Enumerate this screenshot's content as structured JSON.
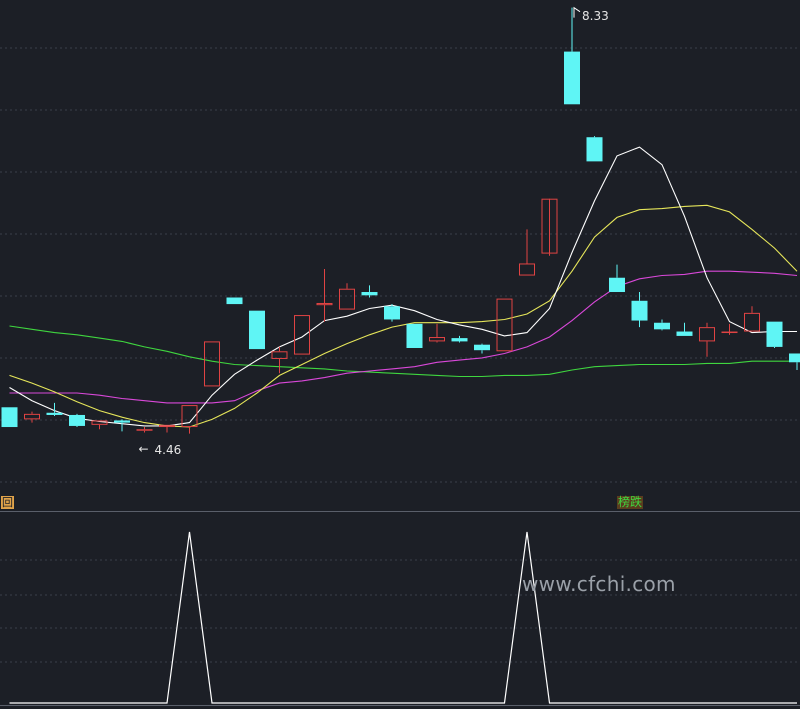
{
  "chart_data": [
    {
      "type": "candlestick",
      "colors": {
        "up": "#e04343",
        "down": "#5ff5f5",
        "ma_fast": "#ffffff",
        "ma_mid": "#e6e65a",
        "ma_slow": "#d948d9",
        "ma_long": "#3fd63f",
        "grid": "#3a3f4a"
      },
      "ylim": [
        3.9,
        8.4
      ],
      "high_label": "8.33",
      "low_label": "4.46",
      "signal_left": "回",
      "signal_right": "榜跌",
      "candles": [
        {
          "o": 4.69,
          "h": 4.69,
          "l": 4.51,
          "c": 4.51
        },
        {
          "o": 4.58,
          "h": 4.65,
          "l": 4.55,
          "c": 4.63
        },
        {
          "o": 4.64,
          "h": 4.73,
          "l": 4.61,
          "c": 4.62
        },
        {
          "o": 4.62,
          "h": 4.63,
          "l": 4.51,
          "c": 4.52
        },
        {
          "o": 4.53,
          "h": 4.57,
          "l": 4.49,
          "c": 4.57
        },
        {
          "o": 4.57,
          "h": 4.58,
          "l": 4.47,
          "c": 4.55
        },
        {
          "o": 4.49,
          "h": 4.51,
          "l": 4.46,
          "c": 4.49
        },
        {
          "o": 4.51,
          "h": 4.53,
          "l": 4.46,
          "c": 4.53
        },
        {
          "o": 4.51,
          "h": 4.71,
          "l": 4.45,
          "c": 4.71
        },
        {
          "o": 4.88,
          "h": 5.29,
          "l": 4.88,
          "c": 5.29
        },
        {
          "o": 5.69,
          "h": 5.69,
          "l": 5.63,
          "c": 5.63
        },
        {
          "o": 5.57,
          "h": 5.57,
          "l": 5.22,
          "c": 5.22
        },
        {
          "o": 5.13,
          "h": 5.24,
          "l": 5.0,
          "c": 5.2
        },
        {
          "o": 5.17,
          "h": 5.53,
          "l": 5.17,
          "c": 5.53
        },
        {
          "o": 5.62,
          "h": 5.95,
          "l": 5.47,
          "c": 5.64
        },
        {
          "o": 5.58,
          "h": 5.82,
          "l": 5.58,
          "c": 5.77
        },
        {
          "o": 5.74,
          "h": 5.8,
          "l": 5.69,
          "c": 5.71
        },
        {
          "o": 5.61,
          "h": 5.63,
          "l": 5.47,
          "c": 5.49
        },
        {
          "o": 5.45,
          "h": 5.45,
          "l": 5.23,
          "c": 5.23
        },
        {
          "o": 5.29,
          "h": 5.45,
          "l": 5.28,
          "c": 5.33
        },
        {
          "o": 5.32,
          "h": 5.34,
          "l": 5.28,
          "c": 5.29
        },
        {
          "o": 5.26,
          "h": 5.27,
          "l": 5.18,
          "c": 5.21
        },
        {
          "o": 5.2,
          "h": 5.68,
          "l": 5.2,
          "c": 5.68
        },
        {
          "o": 5.89,
          "h": 6.31,
          "l": 5.89,
          "c": 6.0
        },
        {
          "o": 6.09,
          "h": 6.09,
          "l": 6.07,
          "c": 6.59
        },
        {
          "o": 7.93,
          "h": 8.33,
          "l": 7.45,
          "c": 7.45
        },
        {
          "o": 7.15,
          "h": 7.16,
          "l": 6.93,
          "c": 6.93
        },
        {
          "o": 5.87,
          "h": 5.99,
          "l": 5.74,
          "c": 5.74
        },
        {
          "o": 5.66,
          "h": 5.74,
          "l": 5.42,
          "c": 5.48
        },
        {
          "o": 5.46,
          "h": 5.49,
          "l": 5.39,
          "c": 5.4
        },
        {
          "o": 5.38,
          "h": 5.46,
          "l": 5.34,
          "c": 5.34
        },
        {
          "o": 5.29,
          "h": 5.46,
          "l": 5.15,
          "c": 5.42
        },
        {
          "o": 5.37,
          "h": 5.45,
          "l": 5.35,
          "c": 5.38
        },
        {
          "o": 5.38,
          "h": 5.61,
          "l": 5.38,
          "c": 5.55
        },
        {
          "o": 5.47,
          "h": 5.47,
          "l": 5.23,
          "c": 5.24
        },
        {
          "o": 5.18,
          "h": 5.18,
          "l": 5.03,
          "c": 5.1
        }
      ],
      "ma_fast": [
        4.87,
        4.75,
        4.66,
        4.59,
        4.56,
        4.54,
        4.52,
        4.52,
        4.55,
        4.8,
        4.99,
        5.12,
        5.24,
        5.33,
        5.48,
        5.52,
        5.59,
        5.62,
        5.57,
        5.49,
        5.44,
        5.4,
        5.34,
        5.37,
        5.59,
        6.1,
        6.57,
        6.98,
        7.06,
        6.9,
        6.43,
        5.87,
        5.47,
        5.37,
        5.38,
        5.38
      ],
      "ma_mid": [
        4.98,
        4.91,
        4.83,
        4.74,
        4.66,
        4.6,
        4.55,
        4.52,
        4.51,
        4.58,
        4.68,
        4.82,
        4.98,
        5.08,
        5.18,
        5.27,
        5.35,
        5.42,
        5.46,
        5.46,
        5.46,
        5.47,
        5.49,
        5.54,
        5.66,
        5.93,
        6.24,
        6.42,
        6.49,
        6.5,
        6.52,
        6.53,
        6.47,
        6.31,
        6.14,
        5.93
      ],
      "ma_slow": [
        4.82,
        4.82,
        4.82,
        4.82,
        4.8,
        4.77,
        4.75,
        4.73,
        4.73,
        4.73,
        4.75,
        4.84,
        4.91,
        4.93,
        4.96,
        5.0,
        5.02,
        5.04,
        5.06,
        5.1,
        5.12,
        5.14,
        5.18,
        5.24,
        5.33,
        5.48,
        5.65,
        5.79,
        5.86,
        5.89,
        5.9,
        5.93,
        5.93,
        5.92,
        5.91,
        5.89
      ],
      "ma_long": [
        5.43,
        5.4,
        5.37,
        5.35,
        5.32,
        5.29,
        5.24,
        5.2,
        5.15,
        5.11,
        5.08,
        5.07,
        5.06,
        5.05,
        5.04,
        5.02,
        5.01,
        5.0,
        4.99,
        4.98,
        4.97,
        4.97,
        4.98,
        4.98,
        4.99,
        5.03,
        5.06,
        5.07,
        5.08,
        5.08,
        5.08,
        5.09,
        5.09,
        5.11,
        5.11,
        5.11
      ]
    },
    {
      "type": "line",
      "color": "#ffffff",
      "ylim": [
        0,
        1
      ],
      "values": [
        0,
        0,
        0,
        0,
        0,
        0,
        0,
        0,
        1,
        0,
        0,
        0,
        0,
        0,
        0,
        0,
        0,
        0,
        0,
        0,
        0,
        0,
        0,
        1,
        0,
        0,
        0,
        0,
        0,
        0,
        0,
        0,
        0,
        0,
        0,
        0
      ]
    }
  ],
  "watermark": "www.cfchi.com"
}
